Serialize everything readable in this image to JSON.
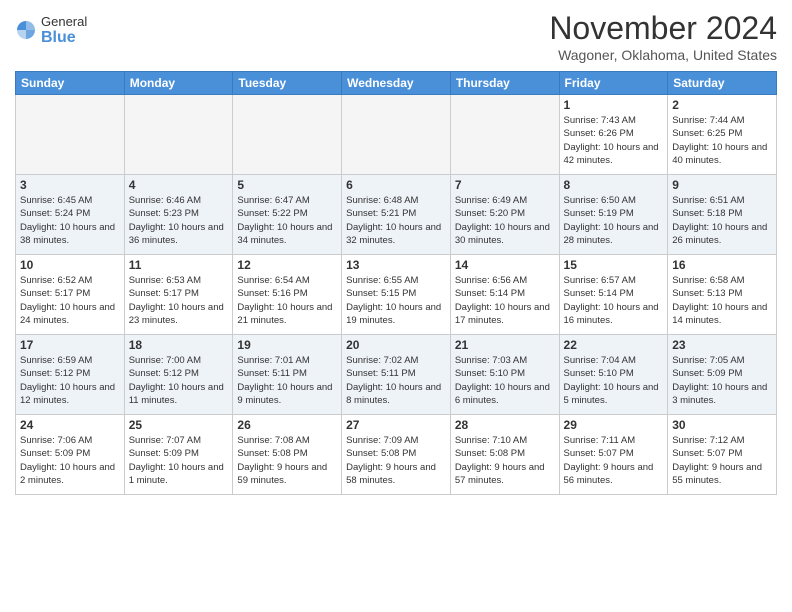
{
  "header": {
    "logo": {
      "general": "General",
      "blue": "Blue"
    },
    "title": "November 2024",
    "location": "Wagoner, Oklahoma, United States"
  },
  "days_of_week": [
    "Sunday",
    "Monday",
    "Tuesday",
    "Wednesday",
    "Thursday",
    "Friday",
    "Saturday"
  ],
  "weeks": [
    {
      "row_class": "row-odd",
      "days": [
        {
          "num": "",
          "info": "",
          "empty": true
        },
        {
          "num": "",
          "info": "",
          "empty": true
        },
        {
          "num": "",
          "info": "",
          "empty": true
        },
        {
          "num": "",
          "info": "",
          "empty": true
        },
        {
          "num": "",
          "info": "",
          "empty": true
        },
        {
          "num": "1",
          "info": "Sunrise: 7:43 AM\nSunset: 6:26 PM\nDaylight: 10 hours\nand 42 minutes.",
          "empty": false
        },
        {
          "num": "2",
          "info": "Sunrise: 7:44 AM\nSunset: 6:25 PM\nDaylight: 10 hours\nand 40 minutes.",
          "empty": false
        }
      ]
    },
    {
      "row_class": "row-even",
      "days": [
        {
          "num": "3",
          "info": "Sunrise: 6:45 AM\nSunset: 5:24 PM\nDaylight: 10 hours\nand 38 minutes.",
          "empty": false
        },
        {
          "num": "4",
          "info": "Sunrise: 6:46 AM\nSunset: 5:23 PM\nDaylight: 10 hours\nand 36 minutes.",
          "empty": false
        },
        {
          "num": "5",
          "info": "Sunrise: 6:47 AM\nSunset: 5:22 PM\nDaylight: 10 hours\nand 34 minutes.",
          "empty": false
        },
        {
          "num": "6",
          "info": "Sunrise: 6:48 AM\nSunset: 5:21 PM\nDaylight: 10 hours\nand 32 minutes.",
          "empty": false
        },
        {
          "num": "7",
          "info": "Sunrise: 6:49 AM\nSunset: 5:20 PM\nDaylight: 10 hours\nand 30 minutes.",
          "empty": false
        },
        {
          "num": "8",
          "info": "Sunrise: 6:50 AM\nSunset: 5:19 PM\nDaylight: 10 hours\nand 28 minutes.",
          "empty": false
        },
        {
          "num": "9",
          "info": "Sunrise: 6:51 AM\nSunset: 5:18 PM\nDaylight: 10 hours\nand 26 minutes.",
          "empty": false
        }
      ]
    },
    {
      "row_class": "row-odd",
      "days": [
        {
          "num": "10",
          "info": "Sunrise: 6:52 AM\nSunset: 5:17 PM\nDaylight: 10 hours\nand 24 minutes.",
          "empty": false
        },
        {
          "num": "11",
          "info": "Sunrise: 6:53 AM\nSunset: 5:17 PM\nDaylight: 10 hours\nand 23 minutes.",
          "empty": false
        },
        {
          "num": "12",
          "info": "Sunrise: 6:54 AM\nSunset: 5:16 PM\nDaylight: 10 hours\nand 21 minutes.",
          "empty": false
        },
        {
          "num": "13",
          "info": "Sunrise: 6:55 AM\nSunset: 5:15 PM\nDaylight: 10 hours\nand 19 minutes.",
          "empty": false
        },
        {
          "num": "14",
          "info": "Sunrise: 6:56 AM\nSunset: 5:14 PM\nDaylight: 10 hours\nand 17 minutes.",
          "empty": false
        },
        {
          "num": "15",
          "info": "Sunrise: 6:57 AM\nSunset: 5:14 PM\nDaylight: 10 hours\nand 16 minutes.",
          "empty": false
        },
        {
          "num": "16",
          "info": "Sunrise: 6:58 AM\nSunset: 5:13 PM\nDaylight: 10 hours\nand 14 minutes.",
          "empty": false
        }
      ]
    },
    {
      "row_class": "row-even",
      "days": [
        {
          "num": "17",
          "info": "Sunrise: 6:59 AM\nSunset: 5:12 PM\nDaylight: 10 hours\nand 12 minutes.",
          "empty": false
        },
        {
          "num": "18",
          "info": "Sunrise: 7:00 AM\nSunset: 5:12 PM\nDaylight: 10 hours\nand 11 minutes.",
          "empty": false
        },
        {
          "num": "19",
          "info": "Sunrise: 7:01 AM\nSunset: 5:11 PM\nDaylight: 10 hours\nand 9 minutes.",
          "empty": false
        },
        {
          "num": "20",
          "info": "Sunrise: 7:02 AM\nSunset: 5:11 PM\nDaylight: 10 hours\nand 8 minutes.",
          "empty": false
        },
        {
          "num": "21",
          "info": "Sunrise: 7:03 AM\nSunset: 5:10 PM\nDaylight: 10 hours\nand 6 minutes.",
          "empty": false
        },
        {
          "num": "22",
          "info": "Sunrise: 7:04 AM\nSunset: 5:10 PM\nDaylight: 10 hours\nand 5 minutes.",
          "empty": false
        },
        {
          "num": "23",
          "info": "Sunrise: 7:05 AM\nSunset: 5:09 PM\nDaylight: 10 hours\nand 3 minutes.",
          "empty": false
        }
      ]
    },
    {
      "row_class": "row-odd",
      "days": [
        {
          "num": "24",
          "info": "Sunrise: 7:06 AM\nSunset: 5:09 PM\nDaylight: 10 hours\nand 2 minutes.",
          "empty": false
        },
        {
          "num": "25",
          "info": "Sunrise: 7:07 AM\nSunset: 5:09 PM\nDaylight: 10 hours\nand 1 minute.",
          "empty": false
        },
        {
          "num": "26",
          "info": "Sunrise: 7:08 AM\nSunset: 5:08 PM\nDaylight: 9 hours\nand 59 minutes.",
          "empty": false
        },
        {
          "num": "27",
          "info": "Sunrise: 7:09 AM\nSunset: 5:08 PM\nDaylight: 9 hours\nand 58 minutes.",
          "empty": false
        },
        {
          "num": "28",
          "info": "Sunrise: 7:10 AM\nSunset: 5:08 PM\nDaylight: 9 hours\nand 57 minutes.",
          "empty": false
        },
        {
          "num": "29",
          "info": "Sunrise: 7:11 AM\nSunset: 5:07 PM\nDaylight: 9 hours\nand 56 minutes.",
          "empty": false
        },
        {
          "num": "30",
          "info": "Sunrise: 7:12 AM\nSunset: 5:07 PM\nDaylight: 9 hours\nand 55 minutes.",
          "empty": false
        }
      ]
    }
  ]
}
